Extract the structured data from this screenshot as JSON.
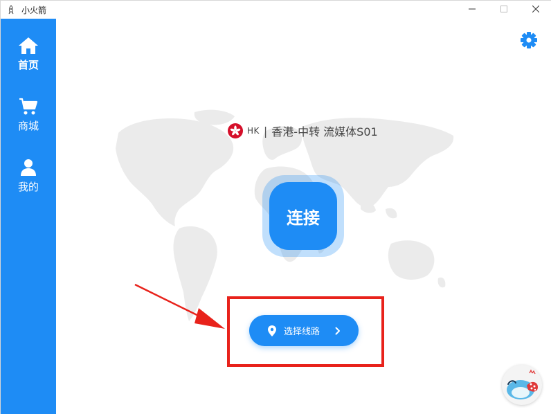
{
  "window": {
    "title": "小火箭",
    "minimize_icon": "minimize-icon",
    "maximize_icon": "maximize-icon",
    "close_icon": "close-icon"
  },
  "sidebar": {
    "items": [
      {
        "label": "首页",
        "icon": "home-icon",
        "active": true
      },
      {
        "label": "商城",
        "icon": "cart-icon",
        "active": false
      },
      {
        "label": "我的",
        "icon": "user-icon",
        "active": false
      }
    ]
  },
  "main": {
    "server": {
      "region_code": "HK",
      "separator": "|",
      "name": "香港-中转 流媒体S01",
      "flag_icon": "hong-kong-flag-icon"
    },
    "connect_label": "连接",
    "route_button": {
      "label": "选择线路",
      "icon": "location-pin-icon",
      "chevron": "chevron-right-icon"
    },
    "settings_icon": "gear-icon"
  },
  "colors": {
    "primary": "#1e8cf5",
    "annotation": "#e8221b",
    "map": "#ebebeb"
  }
}
